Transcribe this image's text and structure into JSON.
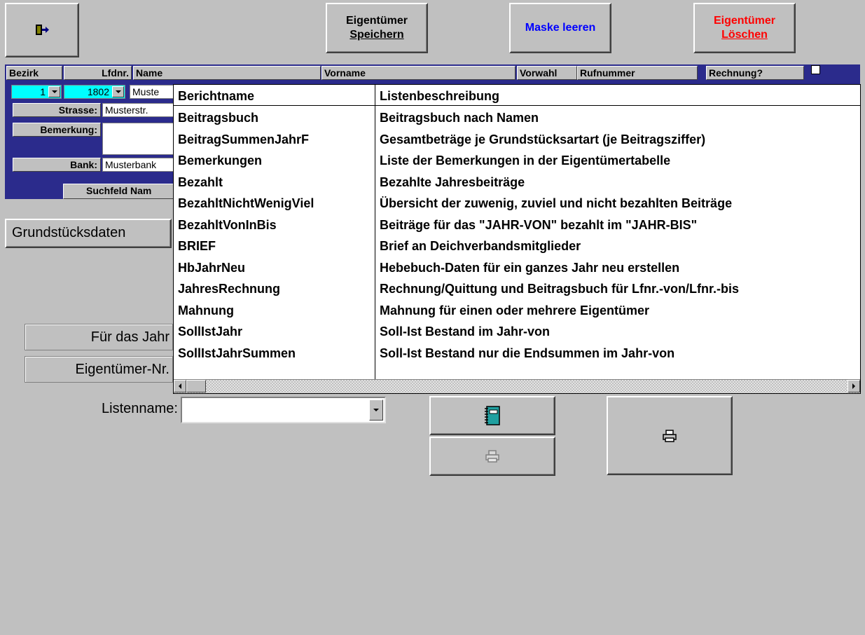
{
  "toolbar": {
    "save_line1": "Eigentümer",
    "save_line2": "Speichern",
    "clear_label": "Maske leeren",
    "delete_line1": "Eigentümer",
    "delete_line2": "Löschen",
    "clear_color": "#0000ff",
    "delete_color": "#ff0000"
  },
  "header": {
    "col_bezirk": "Bezirk",
    "col_lfdnr": "Lfdnr.",
    "col_name": "Name",
    "col_vorname": "Vorname",
    "col_vorwahl": "Vorwahl",
    "col_rufnummer": "Rufnummer",
    "col_rechnung": "Rechnung?",
    "bezirk_value": "1",
    "lfdnr_value": "1802",
    "name_value": "Muste"
  },
  "record": {
    "strasse_label": "Strasse:",
    "strasse_value": "Musterstr.",
    "bemerkung_label": "Bemerkung:",
    "bank_label": "Bank:",
    "bank_value": "Musterbank",
    "suchfeld_label": "Suchfeld Nam"
  },
  "form": {
    "grundstuecksdaten": "Grundstücksdaten",
    "fuer_das_jahr": "Für das Jahr",
    "eigentuemer_nr": "Eigentümer-Nr.",
    "listenname_label": "Listenname:",
    "listenname_value": ""
  },
  "dropdown": {
    "col_berichtname": "Berichtname",
    "col_listenbeschreibung": "Listenbeschreibung",
    "rows": [
      {
        "name": "Beitragsbuch",
        "desc": "Beitragsbuch nach Namen"
      },
      {
        "name": "BeitragSummenJahrF",
        "desc": "Gesamtbeträge je Grundstücksartart (je Beitragsziffer)"
      },
      {
        "name": "Bemerkungen",
        "desc": "Liste der Bemerkungen in der Eigentümertabelle"
      },
      {
        "name": "Bezahlt",
        "desc": "Bezahlte Jahresbeiträge"
      },
      {
        "name": "BezahltNichtWenigViel",
        "desc": "Übersicht der zuwenig, zuviel und nicht bezahlten Beiträge"
      },
      {
        "name": "BezahltVonInBis",
        "desc": "Beiträge für das \"JAHR-VON\" bezahlt im \"JAHR-BIS\""
      },
      {
        "name": "BRIEF",
        "desc": "Brief an Deichverbandsmitglieder"
      },
      {
        "name": "HbJahrNeu",
        "desc": "Hebebuch-Daten für ein ganzes Jahr neu erstellen"
      },
      {
        "name": "JahresRechnung",
        "desc": "Rechnung/Quittung und Beitragsbuch für Lfnr.-von/Lfnr.-bis"
      },
      {
        "name": "Mahnung",
        "desc": "Mahnung für einen oder mehrere Eigentümer"
      },
      {
        "name": "SollIstJahr",
        "desc": "Soll-Ist Bestand im Jahr-von"
      },
      {
        "name": "SollIstJahrSummen",
        "desc": "Soll-Ist Bestand nur die Endsummen im Jahr-von"
      }
    ]
  },
  "icons": {
    "exit": "exit-door-icon",
    "preview": "notebook-icon",
    "print_disabled": "printer-icon",
    "print": "printer-icon"
  }
}
